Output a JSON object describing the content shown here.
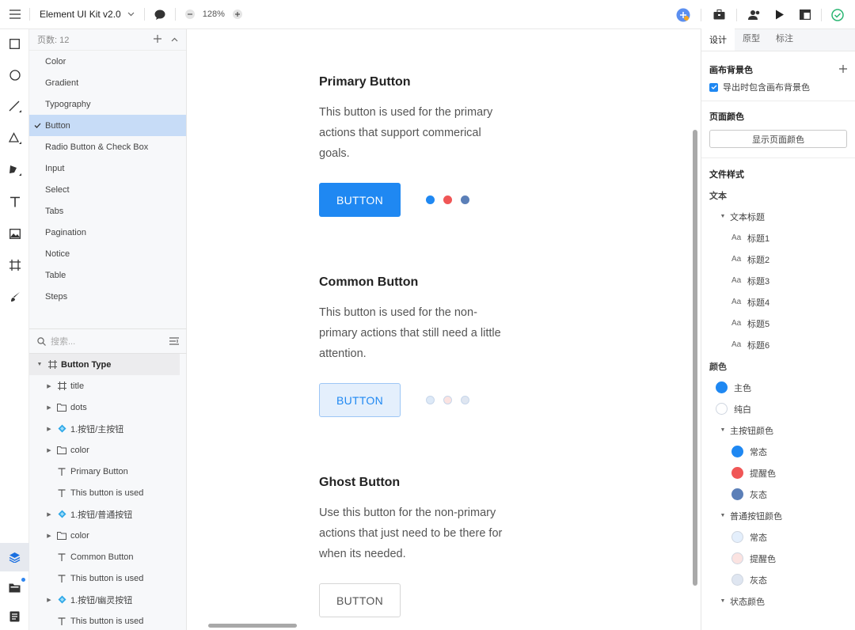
{
  "topbar": {
    "doc_title": "Element UI Kit v2.0",
    "zoom": "128%"
  },
  "pages": {
    "count_label": "页数: 12",
    "items": [
      {
        "label": "Color"
      },
      {
        "label": "Gradient"
      },
      {
        "label": "Typography"
      },
      {
        "label": "Button",
        "selected": true
      },
      {
        "label": "Radio Button & Check Box"
      },
      {
        "label": "Input"
      },
      {
        "label": "Select"
      },
      {
        "label": "Tabs"
      },
      {
        "label": "Pagination"
      },
      {
        "label": "Notice"
      },
      {
        "label": "Table"
      },
      {
        "label": "Steps"
      }
    ]
  },
  "layers": {
    "search_placeholder": "搜索...",
    "items": [
      {
        "label": "Button Type",
        "icon": "frame-icon",
        "indent": 0,
        "caret": "down"
      },
      {
        "label": "title",
        "icon": "frame-icon",
        "indent": 1,
        "caret": "right"
      },
      {
        "label": "dots",
        "icon": "folder-icon",
        "indent": 1,
        "caret": "right"
      },
      {
        "label": "1.按钮/主按钮",
        "icon": "component-icon",
        "indent": 1,
        "caret": "right"
      },
      {
        "label": "color",
        "icon": "folder-icon",
        "indent": 1,
        "caret": "right"
      },
      {
        "label": "Primary Button",
        "icon": "text-icon",
        "indent": 1,
        "caret": ""
      },
      {
        "label": "This button is used",
        "icon": "text-icon",
        "indent": 1,
        "caret": ""
      },
      {
        "label": "1.按钮/普通按钮",
        "icon": "component-icon",
        "indent": 1,
        "caret": "right"
      },
      {
        "label": "color",
        "icon": "folder-icon",
        "indent": 1,
        "caret": "right"
      },
      {
        "label": "Common Button",
        "icon": "text-icon",
        "indent": 1,
        "caret": ""
      },
      {
        "label": "This button is used",
        "icon": "text-icon",
        "indent": 1,
        "caret": ""
      },
      {
        "label": "1.按钮/幽灵按钮",
        "icon": "component-icon",
        "indent": 1,
        "caret": "right"
      },
      {
        "label": "This button is used",
        "icon": "text-icon",
        "indent": 1,
        "caret": ""
      }
    ]
  },
  "canvas": {
    "sections": [
      {
        "title": "Primary Button",
        "desc": "This button is used for the primary actions that support commerical goals.",
        "button_label": "BUTTON",
        "dot_colors": [
          "#1f88f2",
          "#f05656",
          "#5b7fb8"
        ]
      },
      {
        "title": "Common Button",
        "desc": "This button is used for the non-primary actions that still need a little attention.",
        "button_label": "BUTTON",
        "dot_colors": [
          "#dde9f7",
          "#fbe3e1",
          "#dfe6f1"
        ]
      },
      {
        "title": "Ghost Button",
        "desc": "Use this button for the non-primary actions that just need to be there for when its needed.",
        "button_label": "BUTTON"
      }
    ]
  },
  "inspector": {
    "tabs": [
      {
        "label": "设计",
        "active": true
      },
      {
        "label": "原型"
      },
      {
        "label": "标注"
      }
    ],
    "canvas_bg": {
      "title": "画布背景色",
      "checkbox_label": "导出时包含画布背景色",
      "checked": true
    },
    "page_color": {
      "title": "页面颜色",
      "button_label": "显示页面颜色"
    },
    "file_styles": {
      "title": "文件样式",
      "text_group": "文本",
      "text_subgroup": "文本标题",
      "text_styles": [
        "标题1",
        "标题2",
        "标题3",
        "标题4",
        "标题5",
        "标题6"
      ],
      "aa_label": "Aa",
      "color_group": "颜色",
      "colors": [
        {
          "label": "主色",
          "color": "#1f88f2"
        },
        {
          "label": "纯白",
          "color": "#ffffff"
        }
      ],
      "primary_btn_group": "主按钮颜色",
      "primary_btn_colors": [
        {
          "label": "常态",
          "color": "#1f88f2"
        },
        {
          "label": "提醒色",
          "color": "#f05656"
        },
        {
          "label": "灰态",
          "color": "#5b7fb8"
        }
      ],
      "common_btn_group": "普通按钮颜色",
      "common_btn_colors": [
        {
          "label": "常态",
          "color": "#e4effc"
        },
        {
          "label": "提醒色",
          "color": "#fbe3e1"
        },
        {
          "label": "灰态",
          "color": "#dfe6f1"
        }
      ],
      "state_group": "状态颜色"
    }
  }
}
